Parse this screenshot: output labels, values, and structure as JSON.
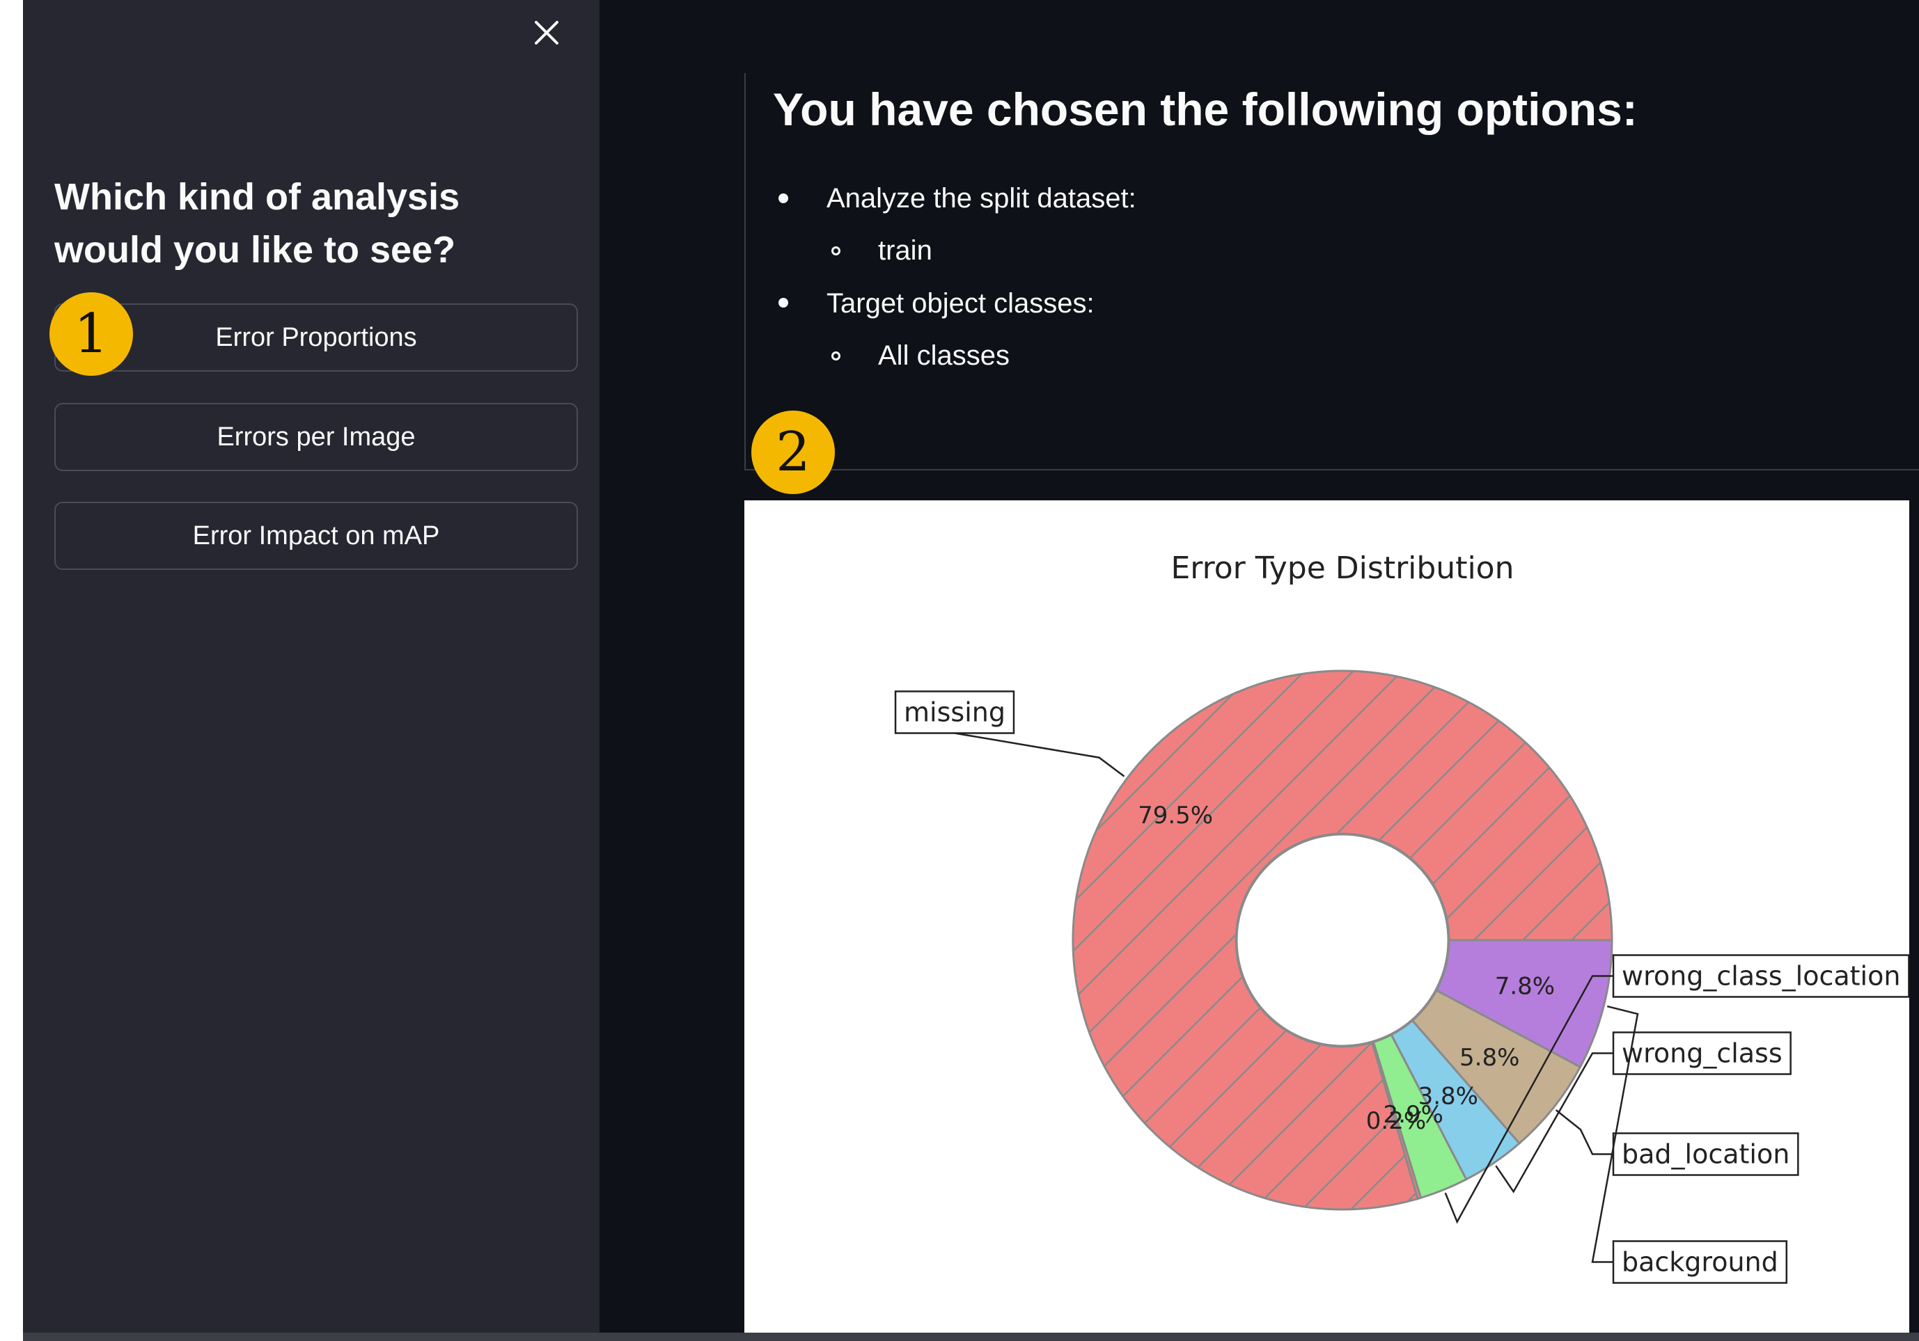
{
  "sidebar": {
    "close_icon": "close-icon",
    "heading_line1": "Which kind of analysis",
    "heading_line2": "would you like to see?",
    "buttons": [
      {
        "label": "Error Proportions"
      },
      {
        "label": "Errors per Image"
      },
      {
        "label": "Error Impact on mAP"
      }
    ]
  },
  "markers": {
    "first": "1",
    "second": "2"
  },
  "main": {
    "title": "You have chosen the following options:",
    "options": [
      {
        "label": "Analyze the split dataset:",
        "value": "train"
      },
      {
        "label": "Target object classes:",
        "value": "All classes"
      }
    ]
  },
  "colors": {
    "sidebar_bg": "#262730",
    "main_bg": "#0e1117",
    "marker": "#f5b800"
  },
  "chart_data": {
    "type": "pie",
    "style": "donut",
    "title": "Error Type Distribution",
    "slices": [
      {
        "label": "missing",
        "pct_label": "79.5%",
        "value": 79.5,
        "color": "#f08080",
        "hatch": true
      },
      {
        "label": "",
        "pct_label": "0.2%",
        "value": 0.2,
        "color": "#f08080",
        "hatch": false
      },
      {
        "label": "wrong_class_location",
        "pct_label": "2.9%",
        "value": 2.9,
        "color": "#90ee90",
        "hatch": false
      },
      {
        "label": "wrong_class",
        "pct_label": "3.8%",
        "value": 3.8,
        "color": "#87ceeb",
        "hatch": false
      },
      {
        "label": "bad_location",
        "pct_label": "5.8%",
        "value": 5.8,
        "color": "#c4b090",
        "hatch": false
      },
      {
        "label": "background",
        "pct_label": "7.8%",
        "value": 7.8,
        "color": "#b57edc",
        "hatch": false
      }
    ]
  }
}
